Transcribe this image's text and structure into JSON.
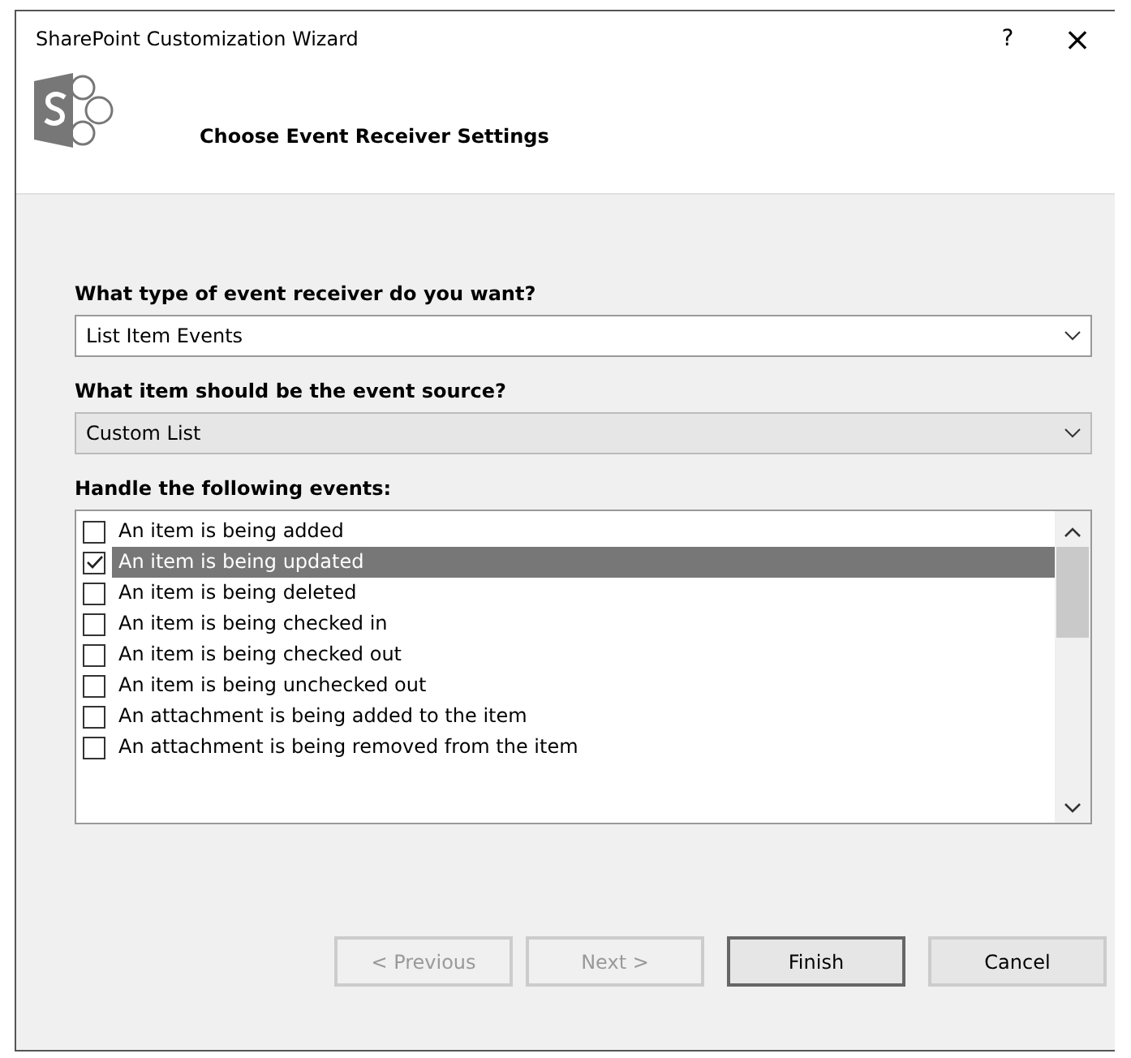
{
  "window": {
    "title": "SharePoint Customization Wizard",
    "help": "?",
    "close": "×"
  },
  "header": {
    "title": "Choose Event Receiver Settings"
  },
  "fields": [
    {
      "label": "What type of event receiver do you want?",
      "value": "List Item Events",
      "disabled": false
    },
    {
      "label": "What item should be the event source?",
      "value": "Custom List",
      "disabled": true
    }
  ],
  "events": {
    "label": "Handle the following events:",
    "items": [
      {
        "label": "An item is being added",
        "checked": false,
        "selected": false
      },
      {
        "label": "An item is being updated",
        "checked": true,
        "selected": true
      },
      {
        "label": "An item is being deleted",
        "checked": false,
        "selected": false
      },
      {
        "label": "An item is being checked in",
        "checked": false,
        "selected": false
      },
      {
        "label": "An item is being checked out",
        "checked": false,
        "selected": false
      },
      {
        "label": "An item is being unchecked out",
        "checked": false,
        "selected": false
      },
      {
        "label": "An attachment is being added to the item",
        "checked": false,
        "selected": false
      },
      {
        "label": "An attachment is being removed from the item",
        "checked": false,
        "selected": false
      }
    ]
  },
  "buttons": [
    {
      "label": "< Previous",
      "disabled": true,
      "default": false
    },
    {
      "label": "Next >",
      "disabled": true,
      "default": false
    },
    {
      "label": "Finish",
      "disabled": false,
      "default": true
    },
    {
      "label": "Cancel",
      "disabled": false,
      "default": false
    }
  ]
}
